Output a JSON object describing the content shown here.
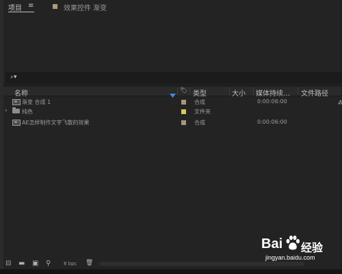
{
  "tabs": {
    "project": "项目",
    "menu_glyph": "≡",
    "effects": "效果控件 渐变",
    "effects_swatch_color": "#b39a78"
  },
  "search": {
    "icon": "search-dropdown-icon",
    "glyph": "⌕▾"
  },
  "table": {
    "columns": {
      "name": "名称",
      "label": "🏷",
      "type": "类型",
      "size": "大小",
      "duration": "媒体持续…",
      "path": "文件路径"
    },
    "rows": [
      {
        "icon": "composition-icon",
        "expand": "",
        "name": "渐变 合成 1",
        "label_color": "#a89580",
        "type": "合成",
        "size": "",
        "duration": "0:00:06:00"
      },
      {
        "icon": "folder-icon",
        "expand": "›",
        "name": "纯色",
        "label_color": "#d8c95a",
        "type": "文件夹",
        "size": "",
        "duration": ""
      },
      {
        "icon": "composition-icon",
        "expand": "",
        "name": "AE怎样制作文字飞散的效果",
        "label_color": "#a89580",
        "type": "合成",
        "size": "",
        "duration": "0:00:06:00"
      }
    ]
  },
  "corner": {
    "glyph": "⁂"
  },
  "footer": {
    "interpret": "⊟",
    "new_folder": "▬",
    "new_comp": "▣",
    "flowchart": "⚲",
    "bpc": "8 bpc",
    "trash": "🗑"
  },
  "watermark": {
    "bai": "Bai",
    "paw": "paw-logo-icon",
    "cn": "经验",
    "url": "jingyan.baidu.com"
  }
}
